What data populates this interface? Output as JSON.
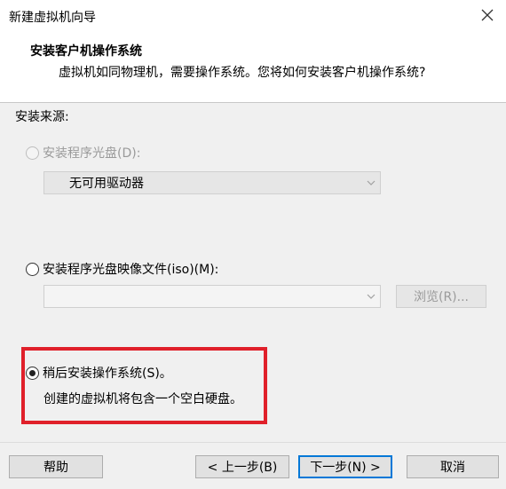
{
  "window": {
    "title": "新建虚拟机向导"
  },
  "header": {
    "title": "安装客户机操作系统",
    "subtitle": "虚拟机如同物理机，需要操作系统。您将如何安装客户机操作系统?"
  },
  "install_source": {
    "label": "安装来源:",
    "options": [
      {
        "label": "安装程序光盘(D):",
        "selected": false,
        "enabled": false
      },
      {
        "label": "安装程序光盘映像文件(iso)(M):",
        "selected": false,
        "enabled": true
      },
      {
        "label": "稍后安装操作系统(S)。",
        "selected": true,
        "enabled": true
      }
    ],
    "drive_select": {
      "value": "无可用驱动器"
    },
    "iso_select": {
      "value": ""
    },
    "browse_button": "浏览(R)...",
    "later_description": "创建的虚拟机将包含一个空白硬盘。"
  },
  "footer": {
    "help": "帮助",
    "back": "< 上一步(B)",
    "next": "下一步(N) >",
    "cancel": "取消"
  },
  "colors": {
    "highlight": "#e0202a",
    "focus": "#0078d7"
  }
}
